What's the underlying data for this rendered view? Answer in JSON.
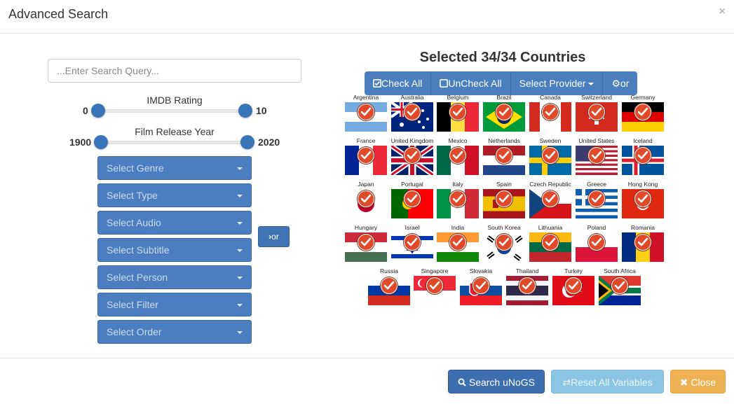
{
  "modal": {
    "title": "Advanced Search",
    "close_glyph": "×"
  },
  "search": {
    "placeholder": "...Enter Search Query..."
  },
  "imdb_slider": {
    "label": "IMDB Rating",
    "min_value": "0",
    "max_value": "10"
  },
  "year_slider": {
    "label": "Film Release Year",
    "min_value": "1900",
    "max_value": "2020"
  },
  "dropdowns": [
    {
      "label": "Select Genre"
    },
    {
      "label": "Select Type"
    },
    {
      "label": "Select Audio"
    },
    {
      "label": "Select Subtitle"
    },
    {
      "label": "Select Person"
    },
    {
      "label": "Select Filter"
    },
    {
      "label": "Select Order"
    }
  ],
  "or_toggle": {
    "label": "or",
    "icon": "chevron-right-icon"
  },
  "countries": {
    "title": "Selected 34/34 Countries",
    "buttons": {
      "check_all": "Check All",
      "uncheck_all": "UnCheck All",
      "select_provider": "Select Provider",
      "gear_or": "or"
    },
    "list": [
      {
        "name": "Argentina",
        "selected": true
      },
      {
        "name": "Australia",
        "selected": true
      },
      {
        "name": "Belgium",
        "selected": true
      },
      {
        "name": "Brazil",
        "selected": true
      },
      {
        "name": "Canada",
        "selected": true
      },
      {
        "name": "Switzerland",
        "selected": true
      },
      {
        "name": "Germany",
        "selected": true
      },
      {
        "name": "France",
        "selected": true
      },
      {
        "name": "United Kingdom",
        "selected": true
      },
      {
        "name": "Mexico",
        "selected": true
      },
      {
        "name": "Netherlands",
        "selected": true
      },
      {
        "name": "Sweden",
        "selected": true
      },
      {
        "name": "United States",
        "selected": true
      },
      {
        "name": "Iceland",
        "selected": true
      },
      {
        "name": "Japan",
        "selected": true
      },
      {
        "name": "Portugal",
        "selected": true
      },
      {
        "name": "Italy",
        "selected": true
      },
      {
        "name": "Spain",
        "selected": true
      },
      {
        "name": "Czech Republic",
        "selected": true
      },
      {
        "name": "Greece",
        "selected": true
      },
      {
        "name": "Hong Kong",
        "selected": true
      },
      {
        "name": "Hungary",
        "selected": true
      },
      {
        "name": "Israel",
        "selected": true
      },
      {
        "name": "India",
        "selected": true
      },
      {
        "name": "South Korea",
        "selected": true
      },
      {
        "name": "Lithuania",
        "selected": true
      },
      {
        "name": "Poland",
        "selected": true
      },
      {
        "name": "Romania",
        "selected": true
      },
      {
        "name": "Russia",
        "selected": true
      },
      {
        "name": "Singapore",
        "selected": true
      },
      {
        "name": "Slovakia",
        "selected": true
      },
      {
        "name": "Thailand",
        "selected": true
      },
      {
        "name": "Turkey",
        "selected": true
      },
      {
        "name": "South Africa",
        "selected": true
      }
    ]
  },
  "footer": {
    "search_label": "Search uNoGS",
    "reset_label": "Reset All Variables",
    "close_label": "Close"
  },
  "colors": {
    "primary": "#3d6fb0",
    "info": "#8ac6e4",
    "warning": "#eeb153",
    "check": "#e04a2a"
  }
}
